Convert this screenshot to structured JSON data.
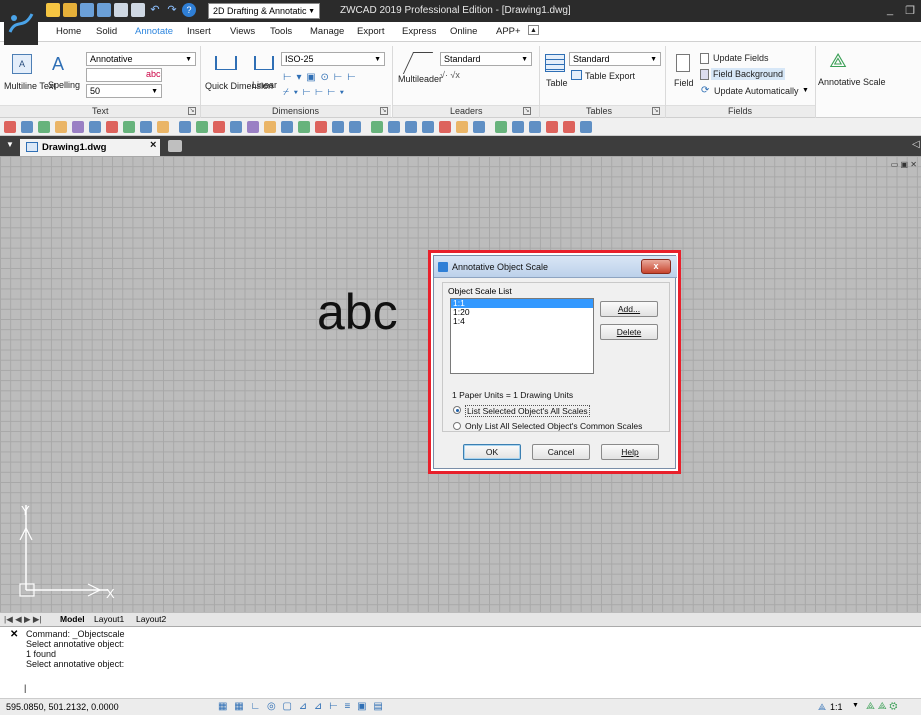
{
  "titlebar": {
    "workspace": "2D Drafting & Annotatic",
    "title": "ZWCAD 2019 Professional Edition - [Drawing1.dwg]",
    "minimize": "_",
    "restore": "❐"
  },
  "tabs": [
    "Home",
    "Solid",
    "Annotate",
    "Insert",
    "Views",
    "Tools",
    "Manage",
    "Export",
    "Express",
    "Online",
    "APP+"
  ],
  "active_tab": "Annotate",
  "ribbon": {
    "text_group": {
      "label": "Text",
      "multiline_text": "Multiline Text",
      "spelling": "Spelling",
      "style": "Annotative",
      "height": "50"
    },
    "dimensions_group": {
      "label": "Dimensions",
      "quick_dimension": "Quick Dimension",
      "linear": "Linear",
      "style": "ISO-25"
    },
    "leaders_group": {
      "label": "Leaders",
      "multileader": "Multileader",
      "style": "Standard"
    },
    "tables_group": {
      "label": "Tables",
      "table": "Table",
      "style": "Standard",
      "table_export": "Table Export"
    },
    "fields_group": {
      "label": "Fields",
      "field": "Field",
      "update_fields": "Update Fields",
      "field_background": "Field Background",
      "update_automatically": "Update Automatically"
    },
    "annotative_scale": "Annotative Scale"
  },
  "document": {
    "tab": "Drawing1.dwg",
    "close": "×",
    "content_text": "abc"
  },
  "layout_tabs": [
    "Model",
    "Layout1",
    "Layout2"
  ],
  "command": {
    "lines": [
      "Command: _Objectscale",
      "Select annotative object:",
      "1 found",
      "Select annotative object:"
    ],
    "prompt": "|"
  },
  "status": {
    "coords": "595.0850, 501.2132, 0.0000",
    "scale": "1:1"
  },
  "dialog": {
    "title": "Annotative Object Scale",
    "close": "x",
    "group_label": "Object Scale List",
    "scales": [
      "1:1",
      "1:20",
      "1:4"
    ],
    "selected_scale": "1:1",
    "add": "Add...",
    "delete": "Delete",
    "units_text": "1 Paper Units = 1 Drawing Units",
    "radio1": "List Selected Object's All Scales",
    "radio2": "Only List All Selected Object's Common Scales",
    "radio_selected": 1,
    "ok": "OK",
    "cancel": "Cancel",
    "help": "Help"
  },
  "colors": {
    "accent": "#2e86de",
    "dialog_highlight": "#e8202b",
    "selection": "#3399ff"
  }
}
